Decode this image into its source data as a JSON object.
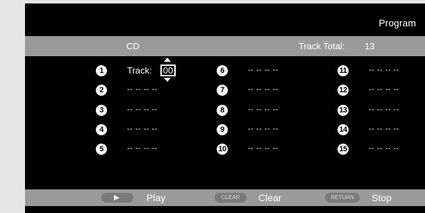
{
  "screen": {
    "title": "Program"
  },
  "header": {
    "source": "CD",
    "track_total_label": "Track Total:",
    "track_total_value": "13"
  },
  "editor": {
    "label": "Track:",
    "value": "00"
  },
  "slots": [
    {
      "num": "1",
      "text": ""
    },
    {
      "num": "2",
      "text": "-- -- -- --"
    },
    {
      "num": "3",
      "text": "-- -- -- --"
    },
    {
      "num": "4",
      "text": "-- -- -- --"
    },
    {
      "num": "5",
      "text": "-- -- -- --"
    },
    {
      "num": "6",
      "text": "-- -- -- --"
    },
    {
      "num": "7",
      "text": "-- -- -- --"
    },
    {
      "num": "8",
      "text": "-- -- -- --"
    },
    {
      "num": "9",
      "text": "-- -- -- --"
    },
    {
      "num": "10",
      "text": "-- -- -- --"
    },
    {
      "num": "11",
      "text": "-- -- -- --"
    },
    {
      "num": "12",
      "text": "-- -- -- --"
    },
    {
      "num": "13",
      "text": "-- -- -- --"
    },
    {
      "num": "14",
      "text": "-- -- -- --"
    },
    {
      "num": "15",
      "text": "-- -- -- --"
    }
  ],
  "footer": {
    "play_label": "Play",
    "clear_key": "CLEAR",
    "clear_label": "Clear",
    "return_key": "RETURN",
    "stop_label": "Stop"
  }
}
